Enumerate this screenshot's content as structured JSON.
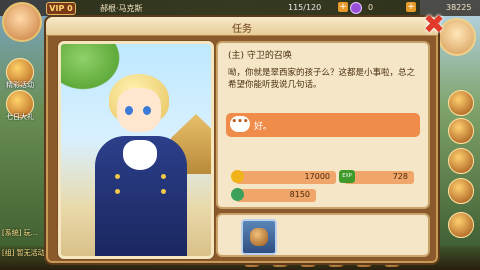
{
  "hud": {
    "vip_label": "VIP 0",
    "player_name": "郝根·马克斯",
    "energy": "115/120",
    "gem_count": "0",
    "gold_count": "38225",
    "plus": "+",
    "left_labels": [
      "精彩活动",
      "七日大礼"
    ],
    "chat_lines": [
      "[系统] 玩...",
      "[组] 暂无活动报名入副本界面，参加..."
    ]
  },
  "dialog": {
    "title": "任务",
    "close_symbol": "✖",
    "quest_name": "(主) 守卫的召唤",
    "quest_text": "呦，你就是翠西家的孩子么？这都是小事啦，总之希望你能听我说几句话。",
    "reply_bubble": "•••",
    "reply_text": "好。",
    "rewards": [
      {
        "icon": "gold-coin-icon",
        "value": "17000",
        "color": "#f2b21a"
      },
      {
        "icon": "exp-icon",
        "label": "EXP",
        "value": "728",
        "color": "#3f9a2a"
      },
      {
        "icon": "swirl-icon",
        "value": "8150",
        "color": "#3aa05a"
      }
    ],
    "item_icon": "scroll-item-icon"
  }
}
